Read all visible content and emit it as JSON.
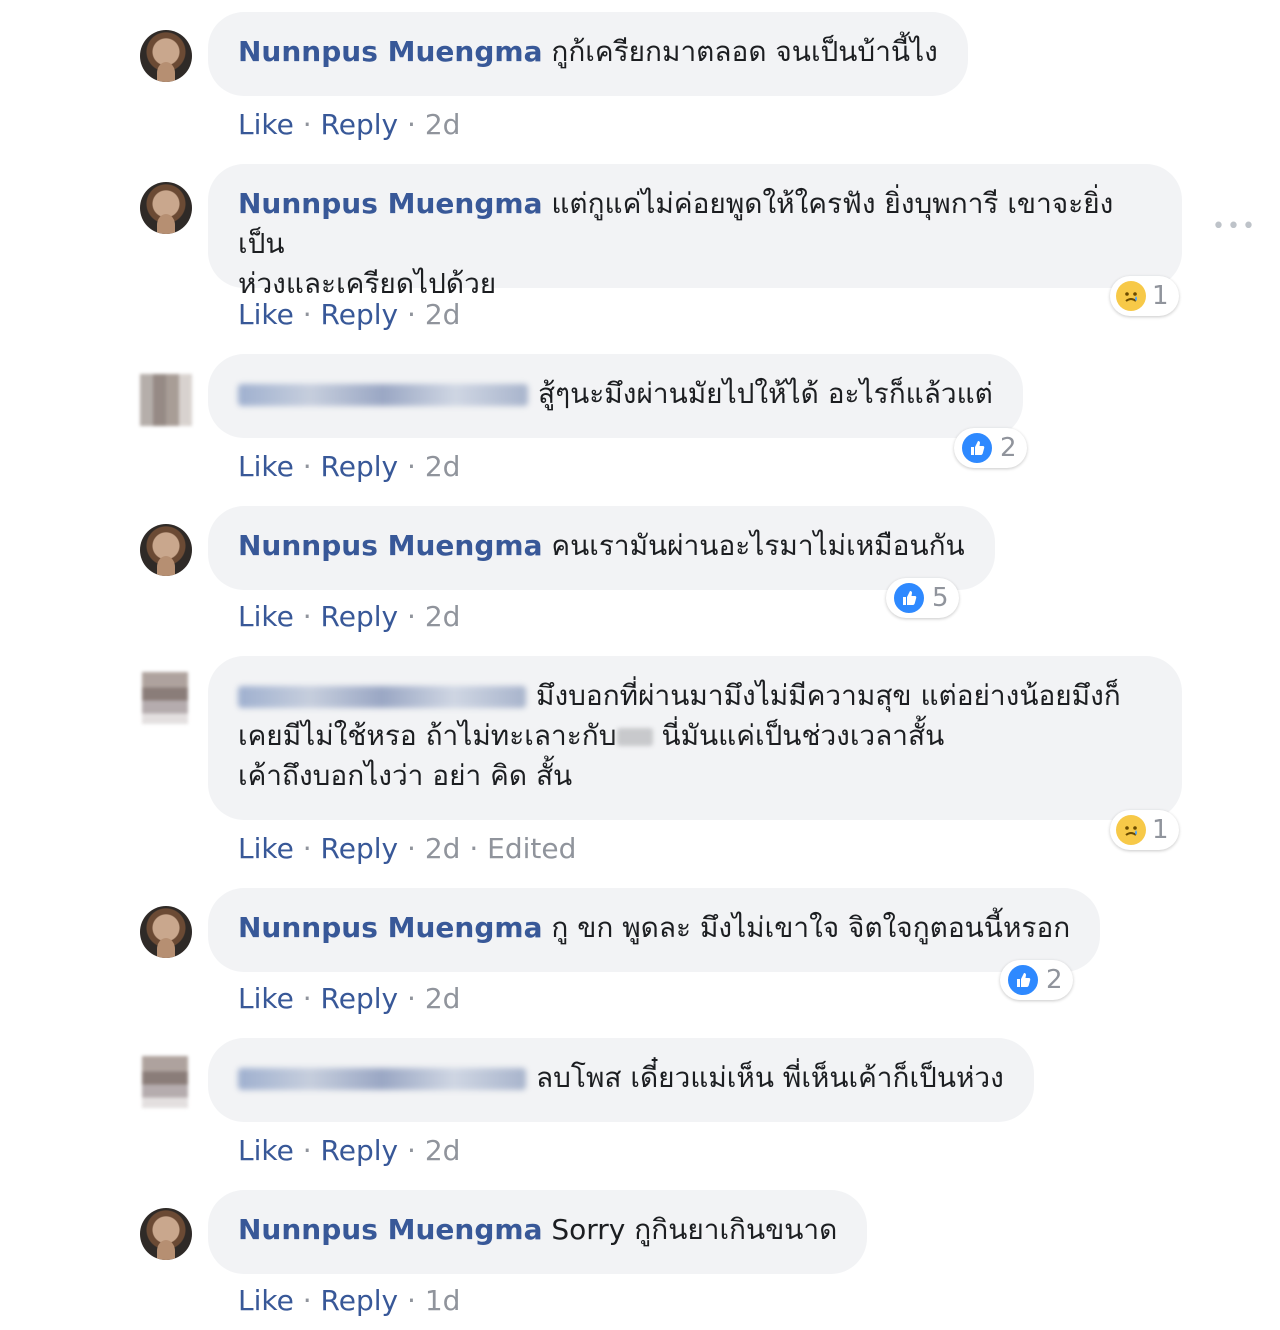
{
  "author_main": "Nunnpus Muengma",
  "actions": {
    "like": "Like",
    "reply": "Reply",
    "dot": "·"
  },
  "more_icon": "•••",
  "comments": [
    {
      "text": "กูก้เครียกมาตลอด จนเป็นบ้านี้ไง",
      "time": "2d"
    },
    {
      "text_line1": "แต่กูแค่ไม่ค่อยพูดให้ใครฟัง ยิ่งบุพการี เขาจะยิ่งเป็น",
      "text_line2": "ห่วงและเครียดไปด้วย",
      "time": "2d",
      "reaction": {
        "icon": "sad-icon",
        "count": "1"
      }
    },
    {
      "text": "สู้ๆนะมึงผ่านมัยไปให้ได้ อะไรก็แล้วแต่",
      "time": "2d",
      "reaction": {
        "icon": "like-icon",
        "count": "2"
      }
    },
    {
      "text": "คนเรามันผ่านอะไรมาไม่เหมือนกัน",
      "time": "2d",
      "reaction": {
        "icon": "like-icon",
        "count": "5"
      }
    },
    {
      "text_line1": "มึงบอกที่ผ่านมามึงไม่มีความสุข แต่อย่างน้อยมึงก็",
      "text_line2a": "เคยมีไม่ใช้หรอ ถ้าไม่ทะเลาะกับ",
      "text_line2b": "นี่มันแค่เป็นช่วงเวลาสั้น",
      "text_line3": "เค้าถึงบอกไงว่า อย่า คิด สั้น",
      "time": "2d",
      "edited": "Edited",
      "reaction": {
        "icon": "sad-icon",
        "count": "1"
      }
    },
    {
      "text": "กู ขก พูดละ มึงไม่เขาใจ จิตใจกูตอนนี้หรอก",
      "time": "2d",
      "reaction": {
        "icon": "like-icon",
        "count": "2"
      }
    },
    {
      "text": "ลบโพส เดี๋ยวแม่เห็น พี่เห็นเค้าก็เป็นห่วง",
      "time": "2d"
    },
    {
      "text": "Sorry กูกินยาเกินขนาด",
      "time": "1d"
    }
  ],
  "colors": {
    "link": "#385898",
    "bubble": "#f2f3f5",
    "meta": "#90949c",
    "like": "#2e89ff",
    "sad": "#f7c948"
  }
}
